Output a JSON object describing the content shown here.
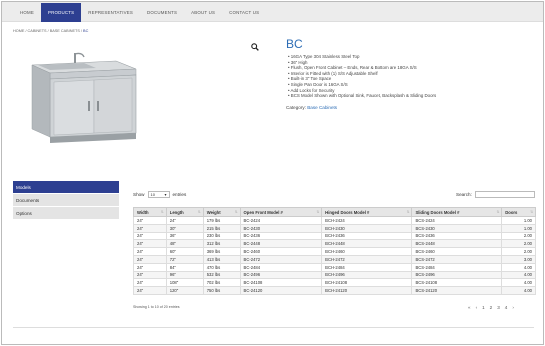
{
  "nav": [
    "HOME",
    "PRODUCTS",
    "REPRESENTATIVES",
    "DOCUMENTS",
    "ABOUT US",
    "CONTACT US"
  ],
  "nav_active": 1,
  "breadcrumb": {
    "trail": "HOME / CABINETS / BASE CABINETS / ",
    "current": "BC"
  },
  "product": {
    "title": "BC",
    "features": [
      "16GA Type 304 Stainless Steel Top",
      "36\" High",
      "Flush, Open Front Cabinet – Ends, Rear & Bottom are 18GA S/S",
      "Interior is Fitted with (1) S/S Adjustable Shelf",
      "Built-in 3\" Toe Space",
      "Single Pan Door is 16GA S/S",
      "Add Locks for Security",
      "BCS Model Shown with Optional Sink, Faucet, Backsplash & Sliding Doors"
    ],
    "category_label": "Category:",
    "category_link": "Base Cabinets"
  },
  "sidebar": [
    "Models",
    "Documents",
    "Options"
  ],
  "sidebar_active": 0,
  "table_controls": {
    "show": "Show",
    "entries_value": "10",
    "entries": "entries",
    "search": "Search:"
  },
  "table": {
    "headers": [
      "Width",
      "Length",
      "Weight",
      "Open Front Model #",
      "Hinged Doors Model #",
      "Sliding Doors Model #",
      "Doors"
    ],
    "rows": [
      [
        "24\"",
        "24\"",
        "179 lbs",
        "BC-2424",
        "BCH-2424",
        "BCS-2424",
        "1.00"
      ],
      [
        "24\"",
        "30\"",
        "215 lbs",
        "BC-2430",
        "BCH-2430",
        "BCS-2430",
        "1.00"
      ],
      [
        "24\"",
        "36\"",
        "230 lbs",
        "BC-2436",
        "BCH-2436",
        "BCS-2436",
        "2.00"
      ],
      [
        "24\"",
        "48\"",
        "312 lbs",
        "BC-2448",
        "BCH-2448",
        "BCS-2448",
        "2.00"
      ],
      [
        "24\"",
        "60\"",
        "369 lbs",
        "BC-2460",
        "BCH-2460",
        "BCS-2460",
        "2.00"
      ],
      [
        "24\"",
        "72\"",
        "413 lbs",
        "BC-2472",
        "BCH-2472",
        "BCS-2472",
        "3.00"
      ],
      [
        "24\"",
        "84\"",
        "470 lbs",
        "BC-2484",
        "BCH-2484",
        "BCS-2484",
        "4.00"
      ],
      [
        "24\"",
        "96\"",
        "532 lbs",
        "BC-2496",
        "BCH-2496",
        "BCS-2496",
        "4.00"
      ],
      [
        "24\"",
        "108\"",
        "702 lbs",
        "BC-24108",
        "BCH-24108",
        "BCS-24108",
        "4.00"
      ],
      [
        "24\"",
        "120\"",
        "750 lbs",
        "BC-24120",
        "BCH-24120",
        "BCS-24120",
        "4.00"
      ]
    ]
  },
  "table_info": "Showing 1 to 10 of 20 entries",
  "pager": {
    "first": "«",
    "prev": "‹",
    "pages": [
      "1",
      "2",
      "3",
      "4"
    ],
    "next": "›"
  }
}
